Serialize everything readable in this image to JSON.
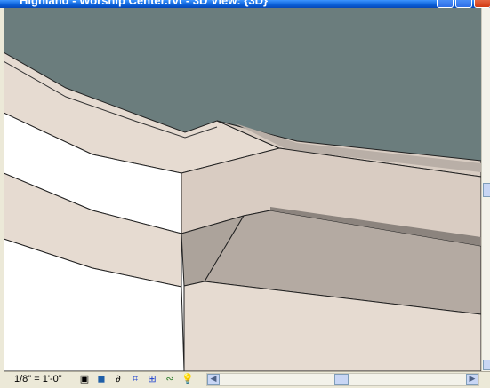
{
  "window": {
    "title": "Highland - Worship Center.rvt - 3D View: {3D}",
    "buttons": {
      "minimize": "_",
      "maximize": "□",
      "close": "✕"
    }
  },
  "view_control_bar": {
    "scale": "1/8\" = 1'-0\"",
    "icons": [
      "detail-level-icon",
      "model-graphics-style-icon",
      "shadows-icon",
      "crop-region-icon",
      "show-crop-icon",
      "temporary-hide-icon",
      "reveal-hidden-icon"
    ]
  },
  "colors": {
    "sky": "#6b7d7d",
    "beige_light": "#e8dcd2",
    "beige_mid": "#d8ccc2",
    "shadow_dark": "#aca39b",
    "xp_blue": "#0a5fd8"
  }
}
